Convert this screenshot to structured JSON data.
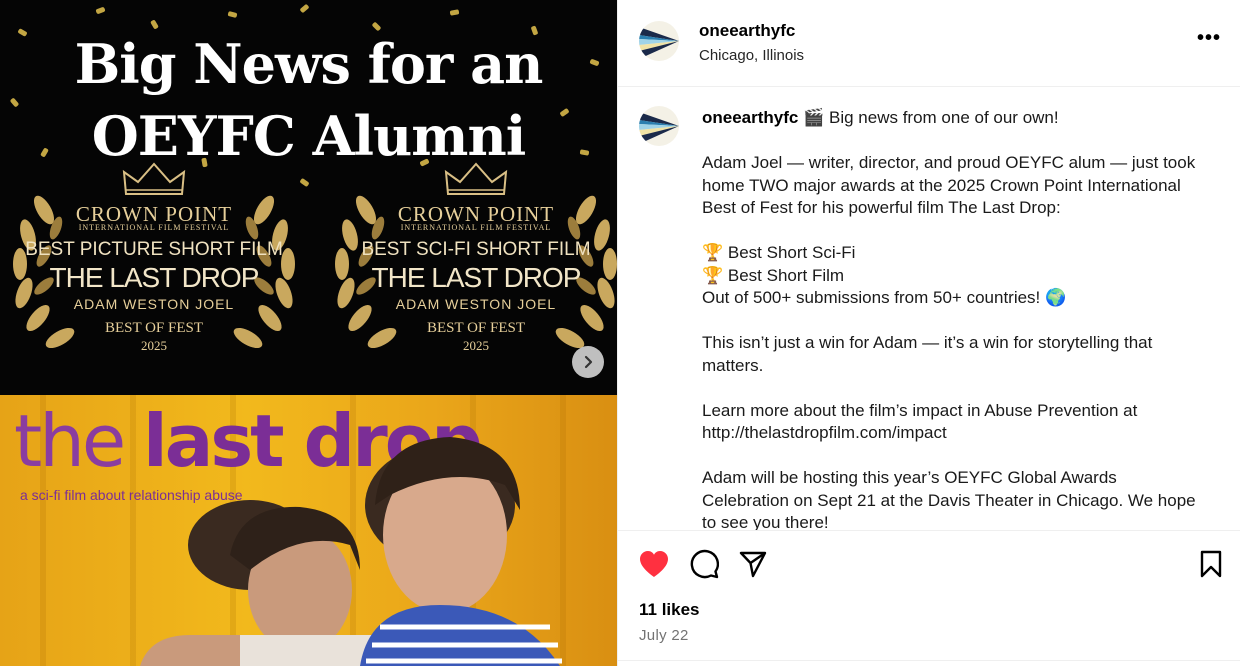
{
  "media": {
    "headline_line1": "Big News for an",
    "headline_line2": "OEYFC Alumni",
    "laurels": [
      {
        "org": "CROWN POINT",
        "festival": "INTERNATIONAL FILM FESTIVAL",
        "award": "BEST PICTURE SHORT FILM",
        "film": "THE LAST DROP",
        "person": "ADAM WESTON JOEL",
        "best_of_fest": "BEST OF FEST",
        "year": "2025"
      },
      {
        "org": "CROWN POINT",
        "festival": "INTERNATIONAL FILM FESTIVAL",
        "award": "BEST SCI-FI SHORT FILM",
        "film": "THE LAST DROP",
        "person": "ADAM WESTON JOEL",
        "best_of_fest": "BEST OF FEST",
        "year": "2025"
      }
    ],
    "film_title_part1": "the ",
    "film_title_part2": "last drop",
    "film_tagline": "a sci-fi film about relationship abuse",
    "next_icon": "chevron-right-icon"
  },
  "post": {
    "username": "oneearthyfc",
    "location": "Chicago, Illinois",
    "more_icon": "more-horizontal-icon",
    "more_label": "•••",
    "caption": {
      "username": "oneearthyfc",
      "line1": " 🎬 Big news from one of our own!",
      "para2": "Adam Joel — writer, director, and proud OEYFC alum — just took home TWO major awards at the 2025 Crown Point International Best of Fest for his powerful film The Last Drop:",
      "award1": "🏆 Best Short Sci-Fi",
      "award2": "🏆 Best Short Film",
      "submissions": "Out of 500+ submissions from 50+ countries! 🌍",
      "para4": "This isn’t just a win for Adam — it’s a win for storytelling that matters.",
      "para5_text": "Learn more about the film’s impact in Abuse Prevention at",
      "para5_link": "http://thelastdropfilm.com/impact",
      "para6": "Adam will be hosting this year’s OEYFC Global Awards Celebration on Sept 21 at the Davis Theater in Chicago. We hope to see you there!"
    },
    "likes": "11 likes",
    "date": "July 22",
    "colors": {
      "like": "#ff3040",
      "muted": "#737373",
      "divider": "#efefef"
    }
  }
}
